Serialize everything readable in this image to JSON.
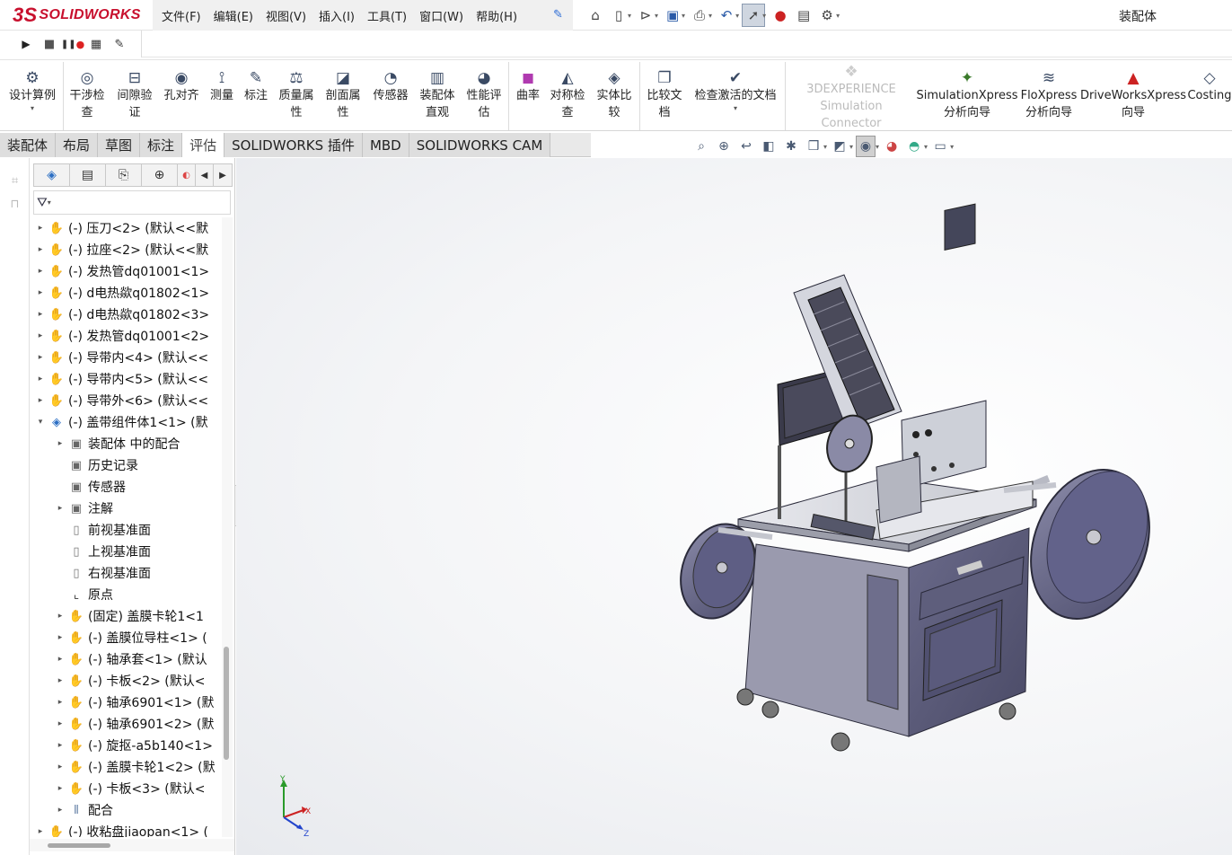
{
  "app": {
    "logo_ds": "3S",
    "logo_text": "SOLIDWORKS",
    "doc_title": "装配体"
  },
  "menu": [
    "文件(F)",
    "编辑(E)",
    "视图(V)",
    "插入(I)",
    "工具(T)",
    "窗口(W)",
    "帮助(H)"
  ],
  "command_manager": [
    {
      "label": "设计算例",
      "icon": "design-study-icon"
    },
    {
      "label": "干涉检\n查",
      "icon": "interference-icon"
    },
    {
      "label": "间隙验\n证",
      "icon": "clearance-icon"
    },
    {
      "label": "孔对齐",
      "icon": "hole-align-icon"
    },
    {
      "label": "测量",
      "icon": "measure-icon"
    },
    {
      "label": "标注",
      "icon": "markup-icon"
    },
    {
      "label": "质量属\n性",
      "icon": "mass-props-icon"
    },
    {
      "label": "剖面属\n性",
      "icon": "section-props-icon"
    },
    {
      "label": "传感器",
      "icon": "sensor-icon"
    },
    {
      "label": "装配体\n直观",
      "icon": "assembly-visual-icon"
    },
    {
      "label": "性能评\n估",
      "icon": "performance-icon"
    },
    {
      "label": "曲率",
      "icon": "curvature-icon"
    },
    {
      "label": "对称检\n查",
      "icon": "symmetry-icon"
    },
    {
      "label": "实体比\n较",
      "icon": "compare-body-icon"
    },
    {
      "label": "比较文\n档",
      "icon": "compare-doc-icon"
    },
    {
      "label": "检查激活的文档",
      "icon": "check-doc-icon"
    },
    {
      "label": "3DEXPERIENCE\nSimulation Connector",
      "icon": "3dx-icon"
    },
    {
      "label": "SimulationXpress\n分析向导",
      "icon": "simxpress-icon"
    },
    {
      "label": "FloXpress\n分析向导",
      "icon": "floxpress-icon"
    },
    {
      "label": "DriveWorksXpress\n向导",
      "icon": "driveworks-icon"
    },
    {
      "label": "Costing",
      "icon": "costing-icon"
    }
  ],
  "tabs": [
    "装配体",
    "布局",
    "草图",
    "标注",
    "评估",
    "SOLIDWORKS 插件",
    "MBD",
    "SOLIDWORKS CAM"
  ],
  "active_tab": "评估",
  "tree": [
    {
      "text": "(-) 压刀<2> (默认<<默",
      "icon": "part",
      "level": 0,
      "expander": "▸"
    },
    {
      "text": "(-) 拉座<2> (默认<<默",
      "icon": "part",
      "level": 0,
      "expander": "▸"
    },
    {
      "text": "(-) 发热管dq01001<1>",
      "icon": "part",
      "level": 0,
      "expander": "▸"
    },
    {
      "text": "(-) d电热歘q01802<1>",
      "icon": "part",
      "level": 0,
      "expander": "▸"
    },
    {
      "text": "(-) d电热歘q01802<3>",
      "icon": "part",
      "level": 0,
      "expander": "▸"
    },
    {
      "text": "(-) 发热管dq01001<2>",
      "icon": "part",
      "level": 0,
      "expander": "▸"
    },
    {
      "text": "(-) 导带内<4> (默认<<",
      "icon": "part",
      "level": 0,
      "expander": "▸"
    },
    {
      "text": "(-) 导带内<5> (默认<<",
      "icon": "part",
      "level": 0,
      "expander": "▸"
    },
    {
      "text": "(-) 导带外<6> (默认<<",
      "icon": "part",
      "level": 0,
      "expander": "▸"
    },
    {
      "text": "(-) 盖带组件体1<1> (默",
      "icon": "asm",
      "level": 0,
      "expander": "▾"
    },
    {
      "text": "装配体 中的配合",
      "icon": "folder",
      "level": 1,
      "expander": "▸"
    },
    {
      "text": "历史记录",
      "icon": "folder",
      "level": 1,
      "expander": ""
    },
    {
      "text": "传感器",
      "icon": "folder",
      "level": 1,
      "expander": ""
    },
    {
      "text": "注解",
      "icon": "folder",
      "level": 1,
      "expander": "▸"
    },
    {
      "text": "前视基准面",
      "icon": "plane",
      "level": 1,
      "expander": ""
    },
    {
      "text": "上视基准面",
      "icon": "plane",
      "level": 1,
      "expander": ""
    },
    {
      "text": "右视基准面",
      "icon": "plane",
      "level": 1,
      "expander": ""
    },
    {
      "text": "原点",
      "icon": "origin",
      "level": 1,
      "expander": ""
    },
    {
      "text": "(固定) 盖膜卡轮1<1",
      "icon": "part",
      "level": 1,
      "expander": "▸"
    },
    {
      "text": "(-) 盖膜位导柱<1> (",
      "icon": "part",
      "level": 1,
      "expander": "▸"
    },
    {
      "text": "(-) 轴承套<1> (默认",
      "icon": "part",
      "level": 1,
      "expander": "▸"
    },
    {
      "text": "(-) 卡板<2> (默认<",
      "icon": "part",
      "level": 1,
      "expander": "▸"
    },
    {
      "text": "(-) 轴承6901<1> (默",
      "icon": "part",
      "level": 1,
      "expander": "▸"
    },
    {
      "text": "(-) 轴承6901<2> (默",
      "icon": "part",
      "level": 1,
      "expander": "▸"
    },
    {
      "text": "(-) 旋抠-a5b140<1>",
      "icon": "part",
      "level": 1,
      "expander": "▸"
    },
    {
      "text": "(-) 盖膜卡轮1<2> (默",
      "icon": "part",
      "level": 1,
      "expander": "▸"
    },
    {
      "text": "(-) 卡板<3> (默认<",
      "icon": "part",
      "level": 1,
      "expander": "▸"
    },
    {
      "text": "配合",
      "icon": "mate",
      "level": 1,
      "expander": "▸"
    },
    {
      "text": "(-) 收粘盘jiaopan<1> (",
      "icon": "part",
      "level": 0,
      "expander": "▸"
    }
  ],
  "triad": {
    "x": "X",
    "y": "Y",
    "z": "Z"
  },
  "colors": {
    "accent": "#c8102e",
    "part_icon": "#d9a400",
    "model_body": "#5a5a7a",
    "model_steel": "#c9cbd2"
  }
}
